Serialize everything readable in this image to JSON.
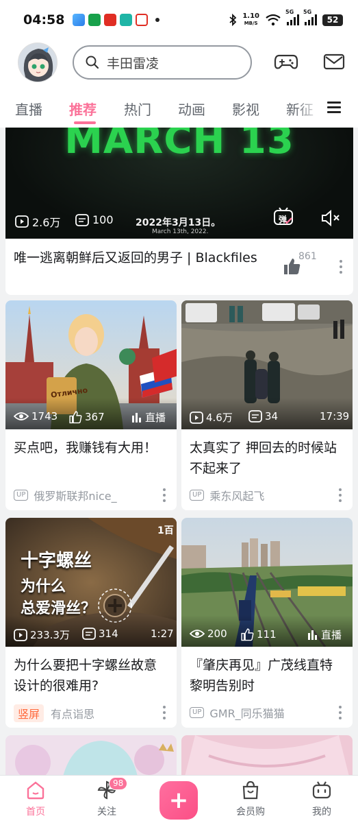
{
  "status_bar": {
    "time": "04:58",
    "net_speed_value": "1.10",
    "net_speed_unit": "MB/S",
    "signal_1": "5G",
    "signal_2": "5G",
    "battery": "52"
  },
  "header": {
    "search_text": "丰田雷凌",
    "icons": [
      "game-controller-icon",
      "mail-icon"
    ]
  },
  "tabs": {
    "items": [
      {
        "label": "直播"
      },
      {
        "label": "推荐"
      },
      {
        "label": "热门"
      },
      {
        "label": "动画"
      },
      {
        "label": "影视"
      },
      {
        "label": "新征"
      }
    ],
    "active": "推荐"
  },
  "feed": {
    "featured": {
      "cover_text": "MARCH 13",
      "cover_date_cn": "2022年3月13日。",
      "cover_date_en": "March 13th, 2022.",
      "views": "2.6万",
      "comments": "100",
      "danmaku_label": "弹",
      "title": "唯一逃离朝鲜后又返回的男子 | Blackfiles",
      "likes": "861"
    },
    "cards": [
      {
        "stat1": "1743",
        "stat2": "367",
        "stat3": "直播",
        "title": "买点吧，我赚钱有大用！",
        "author": "俄罗斯联邦nice_",
        "badge": "UP",
        "cover_text": "Отлично"
      },
      {
        "stat1": "4.6万",
        "stat2": "34",
        "stat3": "17:39",
        "title": "太真实了 押回去的时候站不起来了",
        "author": "乘东风起飞",
        "badge": "UP"
      },
      {
        "stat1": "233.3万",
        "stat2": "314",
        "stat3": "1:27",
        "title": "为什么要把十字螺丝故意设计的很难用?",
        "author": "有点诣思",
        "badge": "竖屏",
        "cover_line1": "十字螺丝",
        "cover_line2": "为什么",
        "cover_line3": "总爱滑丝？",
        "cover_corner": "1百"
      },
      {
        "stat1": "200",
        "stat2": "111",
        "stat3": "直播",
        "title": "『肇庆再见』广茂线直特黎明告别时",
        "author": "GMR_同乐猫猫",
        "badge": "UP"
      }
    ]
  },
  "bottom_nav": {
    "items": [
      {
        "label": "首页"
      },
      {
        "label": "关注",
        "badge": "98"
      },
      {
        "label": "+"
      },
      {
        "label": "会员购"
      },
      {
        "label": "我的"
      }
    ],
    "active": "首页"
  },
  "colors": {
    "accent": "#fb7299",
    "text_primary": "#18191c",
    "text_secondary": "#9499a0",
    "background": "#f1f2f3"
  }
}
